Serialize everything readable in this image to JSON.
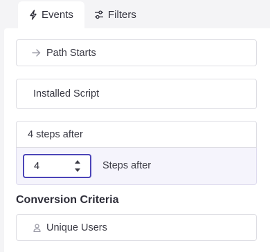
{
  "tabs": [
    {
      "label": "Events",
      "icon": "lightning-icon",
      "active": true
    },
    {
      "label": "Filters",
      "icon": "sliders-icon",
      "active": false
    }
  ],
  "fields": {
    "path_starts": {
      "label": "Path Starts",
      "icon": "arrow-right-icon"
    },
    "installed_script": {
      "label": "Installed Script"
    },
    "steps_select": {
      "value": "4 steps after"
    },
    "steps_input": {
      "value": "4",
      "label": "Steps after"
    }
  },
  "conversion": {
    "title": "Conversion Criteria",
    "users": {
      "label": "Unique Users",
      "icon": "user-icon"
    }
  },
  "colors": {
    "accent": "#4b44b8",
    "dropdown_bg": "#f5f4fc",
    "border": "#dddde3"
  }
}
